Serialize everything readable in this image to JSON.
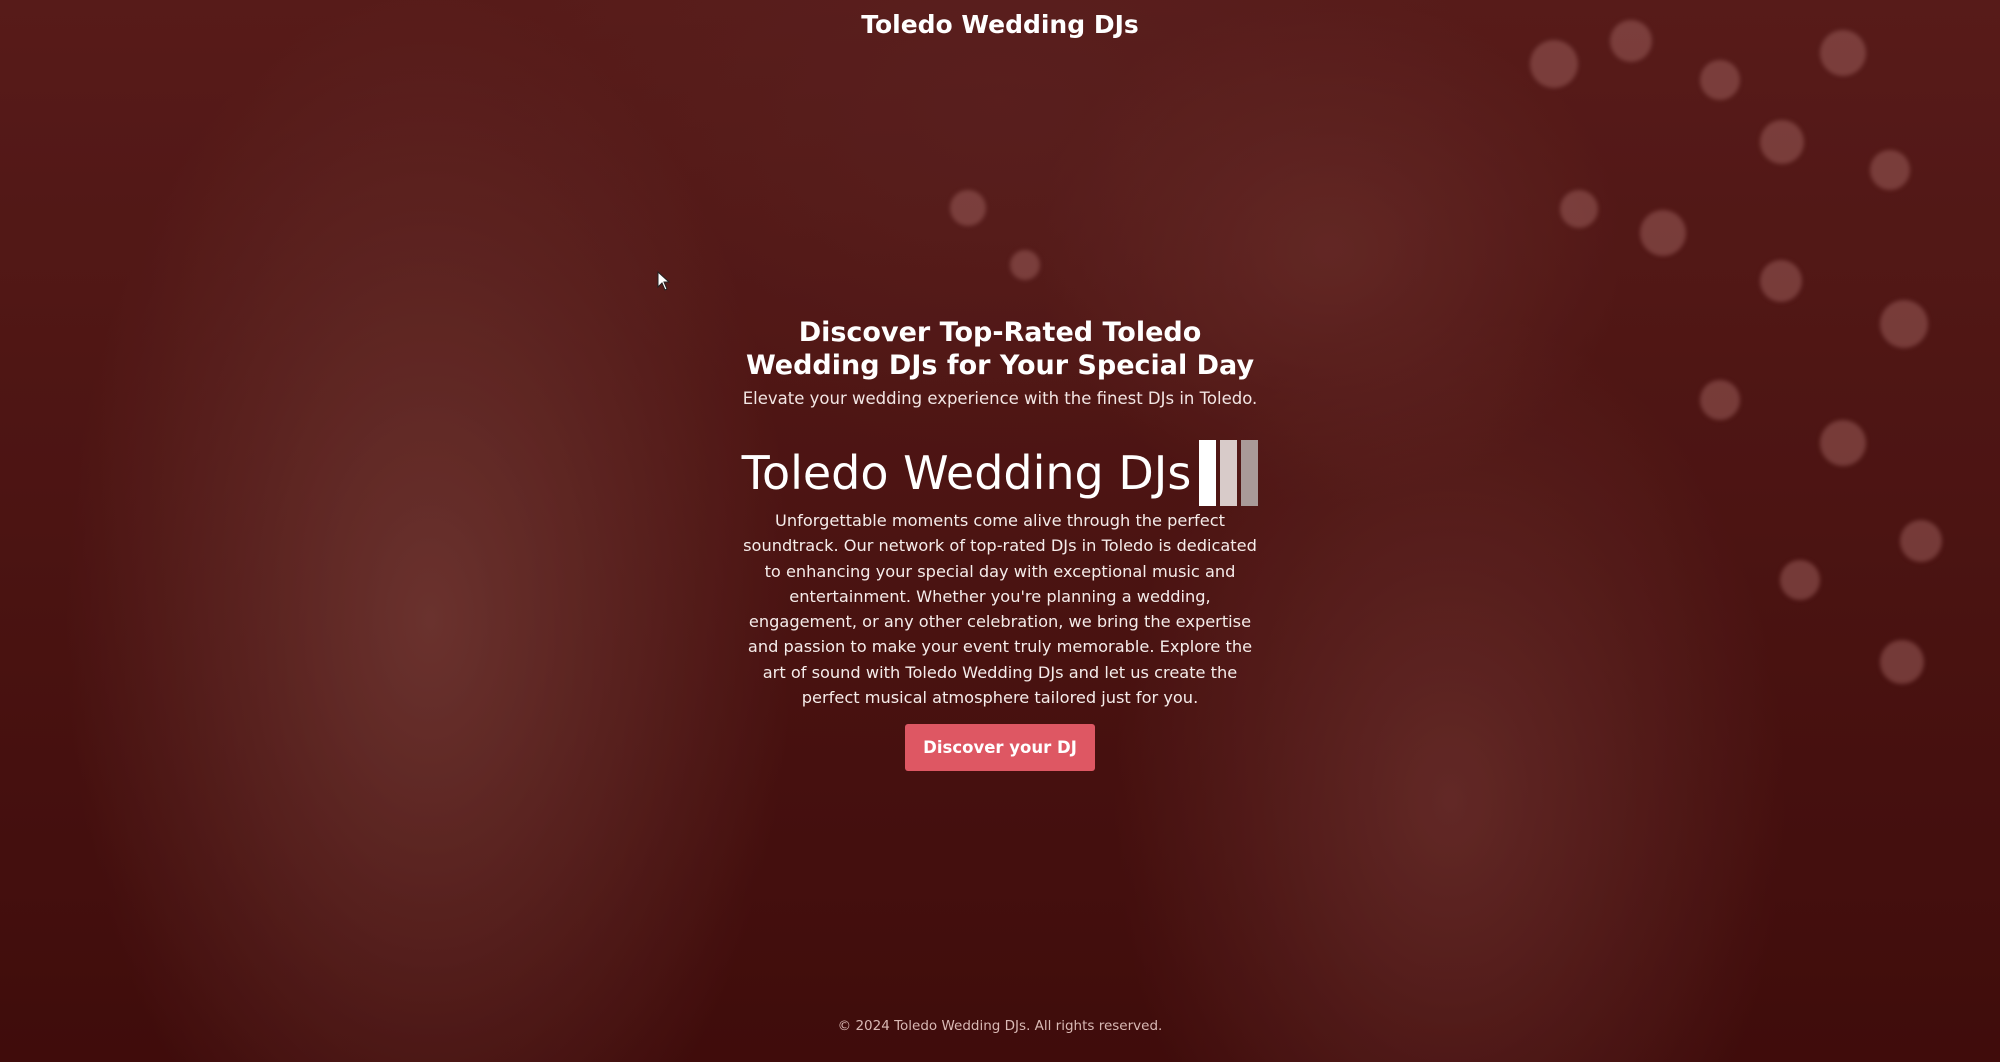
{
  "header": {
    "site_title": "Toledo Wedding DJs"
  },
  "hero": {
    "headline": "Discover Top-Rated Toledo Wedding DJs for Your Special Day",
    "subheadline": "Elevate your wedding experience with the finest DJs in Toledo.",
    "brand_name": "Toledo Wedding DJs",
    "body": "Unforgettable moments come alive through the perfect soundtrack. Our network of top-rated DJs in Toledo is dedicated to enhancing your special day with exceptional music and entertainment. Whether you're planning a wedding, engagement, or any other celebration, we bring the expertise and passion to make your event truly memorable. Explore the art of sound with Toledo Wedding DJs and let us create the perfect musical atmosphere tailored just for you.",
    "cta_label": "Discover your DJ"
  },
  "footer": {
    "copyright": "© 2024 Toledo Wedding DJs. All rights reserved."
  },
  "theme": {
    "background_tint": "#4a1212",
    "cta_color": "#de5763",
    "logo_bar_colors": [
      "#ffffff",
      "#d8cbc9",
      "#a99a98"
    ]
  },
  "icons": {
    "logo": "equalizer-bars-icon",
    "cursor": "mouse-pointer-icon"
  }
}
